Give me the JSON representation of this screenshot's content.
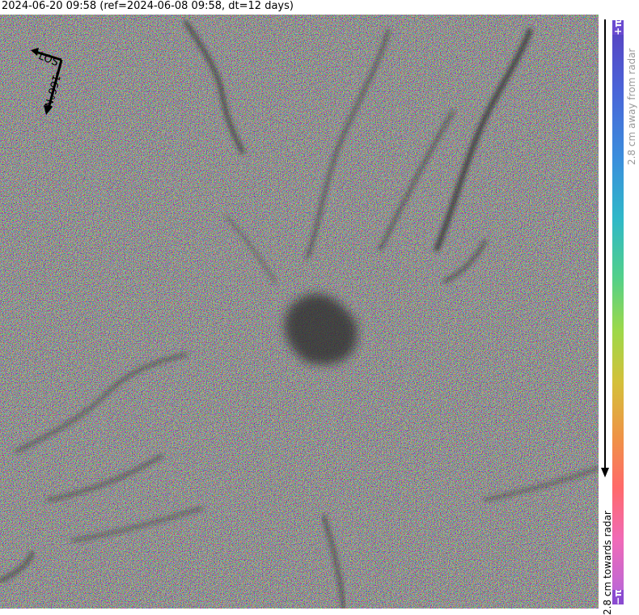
{
  "title": "2024-06-20 09:58 (ref=2024-06-08 09:58, dt=12 days)",
  "map": {
    "los_label": "LOS",
    "heading_label": "-166°N"
  },
  "colorbar": {
    "top_symbol": "+π",
    "bottom_symbol": "−π",
    "away_label": "2.8 cm away from radar",
    "towards_label": "2.8 cm towards radar",
    "colors": [
      "#5a3fbf",
      "#3a8fdc",
      "#52d08a",
      "#d4c03a",
      "#ff6a6a",
      "#b066dd"
    ]
  }
}
